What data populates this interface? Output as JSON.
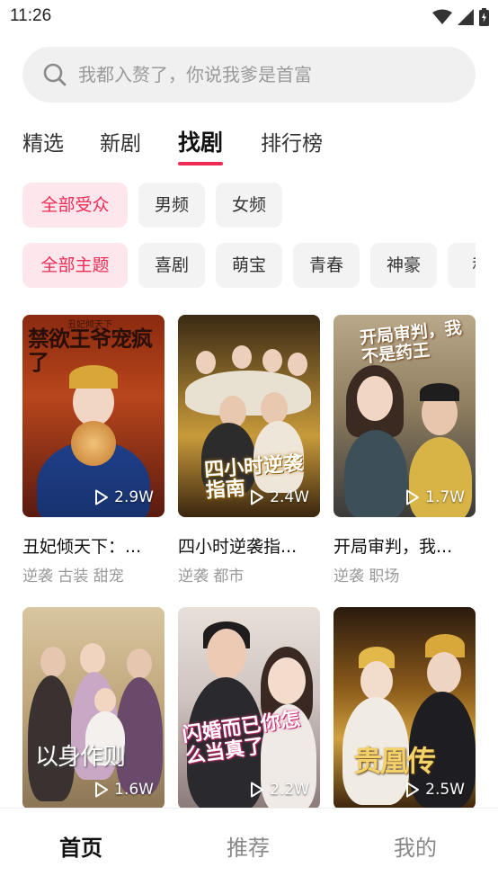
{
  "status_bar": {
    "time": "11:26"
  },
  "search": {
    "placeholder": "我都入赘了，你说我爹是首富"
  },
  "tabs": [
    {
      "label": "精选"
    },
    {
      "label": "新剧"
    },
    {
      "label": "找剧",
      "active": true
    },
    {
      "label": "排行榜"
    }
  ],
  "audience_filters": [
    {
      "label": "全部受众",
      "active": true
    },
    {
      "label": "男频"
    },
    {
      "label": "女频"
    }
  ],
  "theme_filters": [
    {
      "label": "全部主题",
      "active": true
    },
    {
      "label": "喜剧"
    },
    {
      "label": "萌宝"
    },
    {
      "label": "青春"
    },
    {
      "label": "神豪"
    },
    {
      "label": "科"
    }
  ],
  "dramas": [
    {
      "title": "丑妃倾天下：...",
      "tags": "逆袭 古装 甜宠",
      "plays": "2.9W",
      "poster_text": "禁欲王爷宠疯了",
      "poster_subtext": "丑妃倾天下"
    },
    {
      "title": "四小时逆袭指...",
      "tags": "逆袭 都市",
      "plays": "2.4W",
      "poster_text": "四小时逆袭指南"
    },
    {
      "title": "开局审判，我...",
      "tags": "逆袭 职场",
      "plays": "1.7W",
      "poster_text": "开局审判，我不是药王"
    },
    {
      "title": "",
      "tags": "",
      "plays": "1.6W",
      "poster_text": "以身作则"
    },
    {
      "title": "",
      "tags": "",
      "plays": "2.2W",
      "poster_text": "闪婚而已你怎么当真了"
    },
    {
      "title": "",
      "tags": "",
      "plays": "2.5W",
      "poster_text": "贵凰传"
    }
  ],
  "bottom_nav": [
    {
      "label": "首页",
      "active": true
    },
    {
      "label": "推荐"
    },
    {
      "label": "我的"
    }
  ],
  "colors": {
    "accent": "#ee2a55",
    "chip_active_bg": "#fde7ec",
    "chip_bg": "#f3f3f3",
    "search_bg": "#f0f0f0"
  }
}
